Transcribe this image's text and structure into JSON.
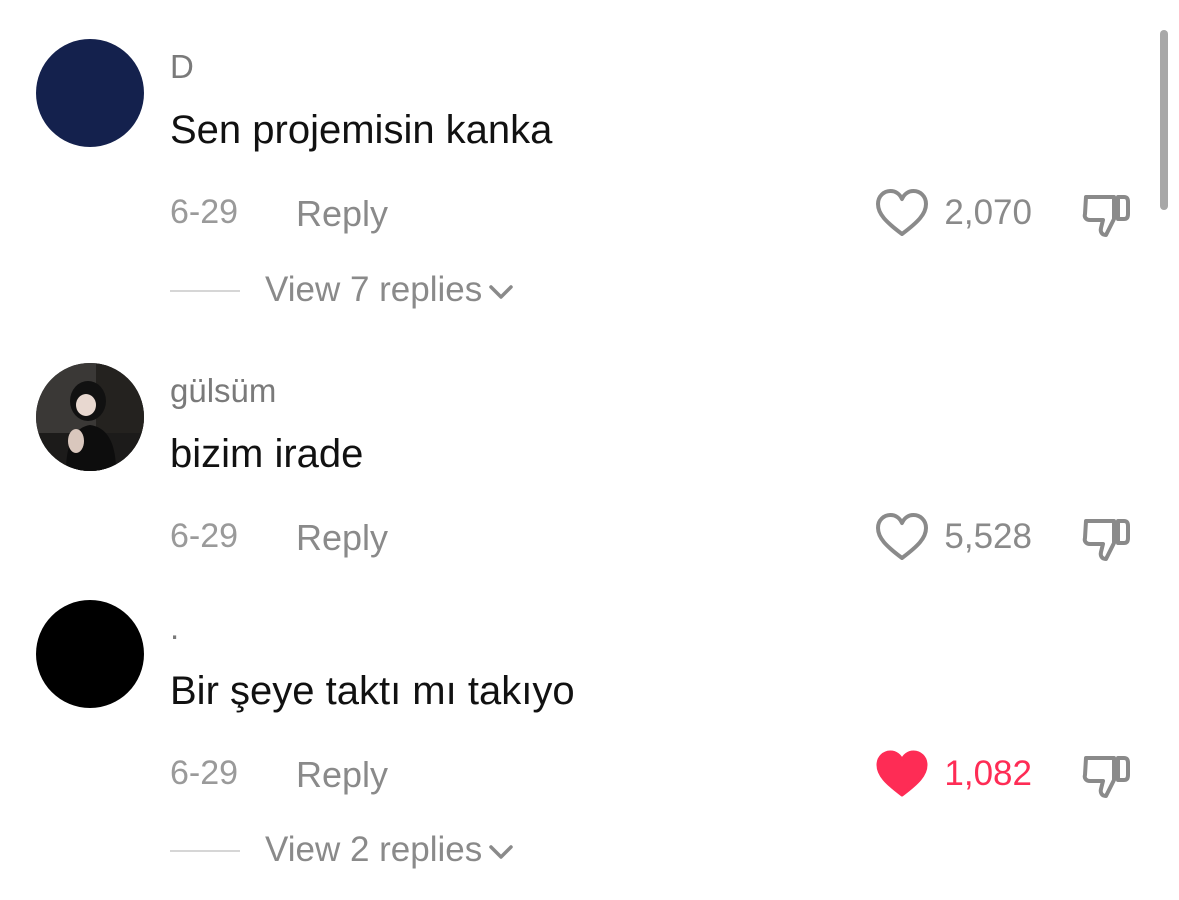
{
  "comments": [
    {
      "username": "D",
      "text": "Sen projemisin kanka",
      "date": "6-29",
      "reply_label": "Reply",
      "likes": "2,070",
      "liked": false,
      "avatar_color": "#14214d",
      "view_replies": "View 7 replies"
    },
    {
      "username": "gülsüm",
      "text": "bizim irade",
      "date": "6-29",
      "reply_label": "Reply",
      "likes": "5,528",
      "liked": false,
      "avatar_color": "#2b2b2b"
    },
    {
      "username": ".",
      "text": "Bir şeye taktı mı takıyo",
      "date": "6-29",
      "reply_label": "Reply",
      "likes": "1,082",
      "liked": true,
      "avatar_color": "#000000",
      "view_replies": "View 2 replies"
    }
  ],
  "icons": {
    "like": "heart-outline-icon",
    "liked": "heart-filled-icon",
    "dislike": "thumbs-down-icon",
    "expand": "chevron-down-icon"
  },
  "colors": {
    "accent_like": "#fe2c55",
    "muted_text": "#8a8a8a"
  }
}
